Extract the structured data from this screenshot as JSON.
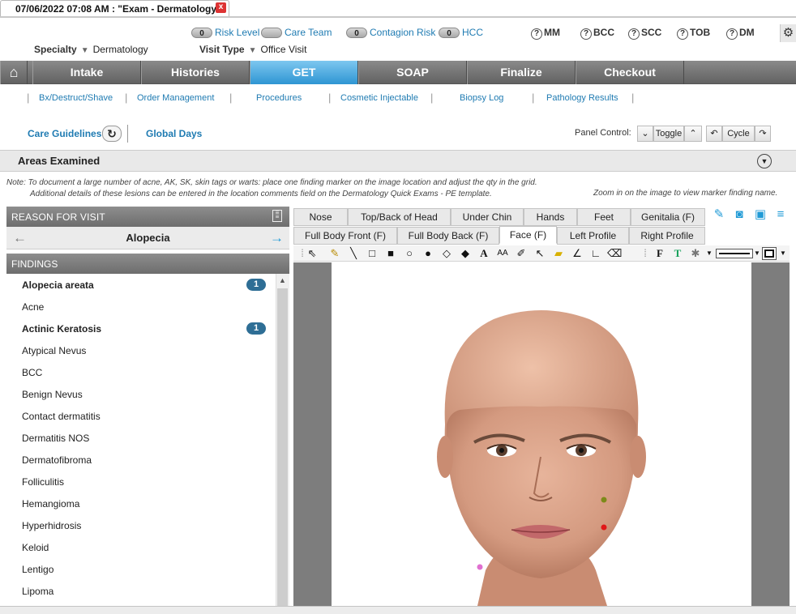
{
  "window": {
    "tab_title": "07/06/2022 07:08 AM : \"Exam - Dermatology\"",
    "close_glyph": "x"
  },
  "header": {
    "specialty_label": "Specialty",
    "specialty_value": "Dermatology",
    "visit_type_label": "Visit Type",
    "visit_type_value": "Office Visit",
    "risk_items": [
      {
        "count": "0",
        "label": "Risk Level"
      },
      {
        "count": "",
        "label": "Care Team"
      },
      {
        "count": "0",
        "label": "Contagion Risk"
      },
      {
        "count": "0",
        "label": "HCC"
      }
    ],
    "quick_buttons": [
      "MM",
      "BCC",
      "SCC",
      "TOB",
      "DM"
    ],
    "settings_icon": "gear-icon"
  },
  "nav": {
    "home_icon": "home-icon",
    "tabs": [
      "Intake",
      "Histories",
      "GET",
      "SOAP",
      "Finalize",
      "Checkout"
    ],
    "active": "GET"
  },
  "subnav": [
    "Bx/Destruct/Shave",
    "Order Management",
    "Procedures",
    "Cosmetic Injectable",
    "Biopsy Log",
    "Pathology Results"
  ],
  "care": {
    "guidelines": "Care Guidelines",
    "global_days": "Global Days",
    "panel_control_label": "Panel Control:",
    "toggle": "Toggle",
    "cycle": "Cycle"
  },
  "areas": {
    "title": "Areas Examined",
    "note_line1": "Note: To document a large number of acne, AK, SK, skin tags or warts: place one finding marker on the image location and adjust the qty in the grid.",
    "note_line2": "Additional details of these lesions can be entered in the location comments field on the Dermatology Quick Exams - PE template.",
    "zoom_note": "Zoom in on the image to view marker finding name."
  },
  "reason_for_visit": {
    "header": "REASON FOR VISIT",
    "value": "Alopecia"
  },
  "findings": {
    "header": "FINDINGS",
    "items": [
      {
        "label": "Alopecia areata",
        "bold": true,
        "count": "1"
      },
      {
        "label": "Acne"
      },
      {
        "label": "Actinic Keratosis",
        "bold": true,
        "count": "1"
      },
      {
        "label": "Atypical Nevus"
      },
      {
        "label": "BCC"
      },
      {
        "label": "Benign Nevus"
      },
      {
        "label": "Contact dermatitis"
      },
      {
        "label": "Dermatitis NOS"
      },
      {
        "label": "Dermatofibroma"
      },
      {
        "label": "Folliculitis"
      },
      {
        "label": "Hemangioma"
      },
      {
        "label": "Hyperhidrosis"
      },
      {
        "label": "Keloid"
      },
      {
        "label": "Lentigo"
      },
      {
        "label": "Lipoma"
      }
    ]
  },
  "image_tabs": {
    "row1": [
      "Nose",
      "Top/Back of Head",
      "Under Chin",
      "Hands",
      "Feet",
      "Genitalia (F)"
    ],
    "row2": [
      "Full Body Front (F)",
      "Full Body Back (F)",
      "Face (F)",
      "Left Profile",
      "Right Profile"
    ],
    "active": "Face (F)"
  },
  "markers": [
    {
      "color": "#7c8a1a"
    },
    {
      "color": "#e01818"
    },
    {
      "color": "#e070d0"
    }
  ],
  "colors": {
    "accent": "#1f7bb2",
    "nav_active": "#2e95d3",
    "badge": "#2e6e95"
  }
}
